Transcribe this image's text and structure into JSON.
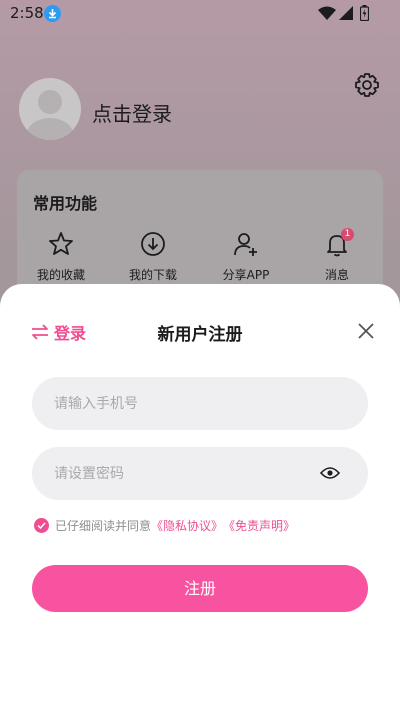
{
  "status_bar": {
    "time": "2:58"
  },
  "profile": {
    "login_prompt": "点击登录"
  },
  "functions": {
    "title": "常用功能",
    "items": [
      {
        "label": "我的收藏",
        "icon": "star-icon"
      },
      {
        "label": "我的下载",
        "icon": "download-icon"
      },
      {
        "label": "分享APP",
        "icon": "add-user-icon"
      },
      {
        "label": "消息",
        "icon": "bell-icon",
        "badge": "1"
      }
    ]
  },
  "sheet": {
    "switch_label": "登录",
    "title": "新用户注册",
    "phone_placeholder": "请输入手机号",
    "password_placeholder": "请设置密码",
    "agree_text": "已仔细阅读并同意",
    "privacy_link": "《隐私协议》",
    "disclaimer_link": "《免责声明》",
    "register_label": "注册"
  },
  "colors": {
    "accent": "#f04d92",
    "button": "#f753a1",
    "input_bg": "#efeef0"
  }
}
